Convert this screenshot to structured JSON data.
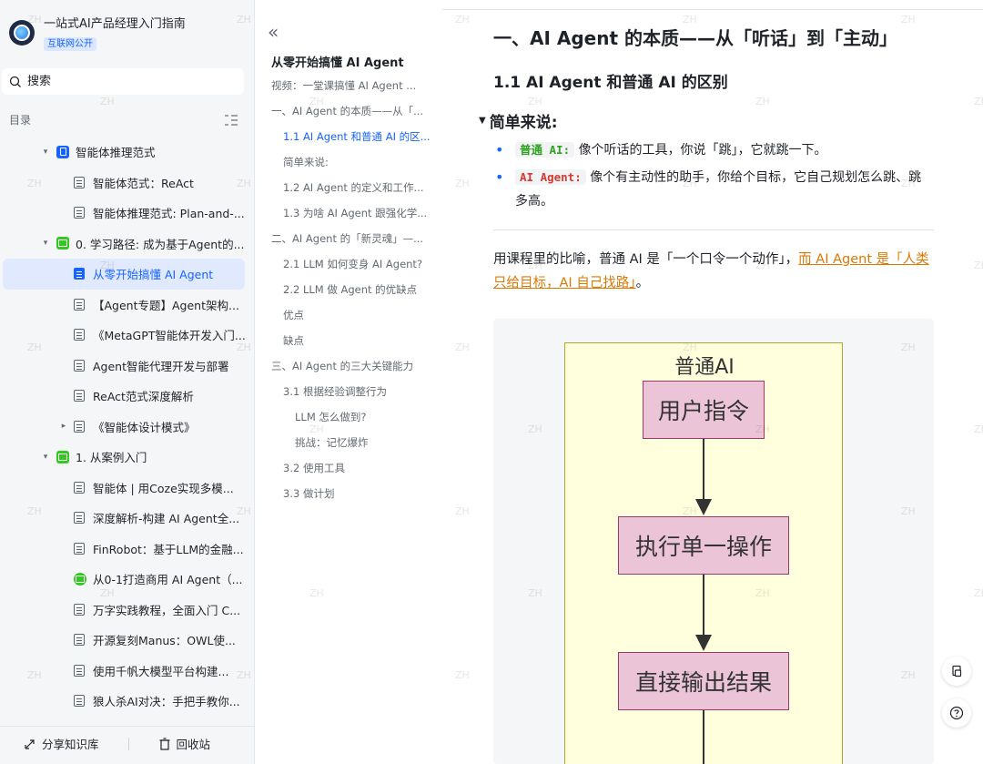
{
  "sidebar": {
    "kb_title": "一站式AI产品经理入门指南",
    "kb_badge": "互联网公开",
    "search_placeholder": "搜索",
    "toc_label": "目录",
    "items": [
      {
        "label": "智能体推理范式",
        "type": "folder-blue",
        "level": 1,
        "caret": "▾"
      },
      {
        "label": "智能体范式：ReAct",
        "type": "doc",
        "level": 2
      },
      {
        "label": "智能体推理范式: Plan-and-...",
        "type": "doc",
        "level": 2
      },
      {
        "label": "0. 学习路径: 成为基于Agent的...",
        "type": "folder-green",
        "level": 1,
        "caret": "▾"
      },
      {
        "label": "从零开始搞懂 AI Agent",
        "type": "doc",
        "level": 2,
        "active": true
      },
      {
        "label": "【Agent专题】Agent架构...",
        "type": "doc",
        "level": 2
      },
      {
        "label": "《MetaGPT智能体开发入门...",
        "type": "doc",
        "level": 2
      },
      {
        "label": "Agent智能代理开发与部署",
        "type": "doc",
        "level": 2
      },
      {
        "label": "ReAct范式深度解析",
        "type": "doc",
        "level": 2
      },
      {
        "label": "《智能体设计模式》",
        "type": "doc",
        "level": 2,
        "caret": "▸"
      },
      {
        "label": "1. 从案例入门",
        "type": "folder-green",
        "level": 1,
        "caret": "▾"
      },
      {
        "label": "智能体 | 用Coze实现多模...",
        "type": "doc",
        "level": 2
      },
      {
        "label": "深度解析-构建 AI Agent全...",
        "type": "doc",
        "level": 2
      },
      {
        "label": "FinRobot：基于LLM的金融...",
        "type": "doc",
        "level": 2
      },
      {
        "label": "从0-1打造商用 AI Agent（...",
        "type": "doc-green",
        "level": 2
      },
      {
        "label": "万字实践教程，全面入门 C...",
        "type": "doc",
        "level": 2
      },
      {
        "label": "开源复刻Manus：OWL使...",
        "type": "doc",
        "level": 2
      },
      {
        "label": "使用千帆大模型平台构建...",
        "type": "doc",
        "level": 2
      },
      {
        "label": "狼人杀AI对决：手把手教你...",
        "type": "doc",
        "level": 2
      }
    ],
    "footer": {
      "share": "分享知识库",
      "trash": "回收站"
    }
  },
  "outline": {
    "collapse": "«",
    "title": "从零开始搞懂 AI Agent",
    "items": [
      {
        "label": "视频：一堂课搞懂 AI Agent ...",
        "level": 0
      },
      {
        "label": "一、AI Agent 的本质——从「...",
        "level": 0
      },
      {
        "label": "1.1 AI Agent 和普通 AI 的区...",
        "level": 1,
        "active": true
      },
      {
        "label": "简单来说:",
        "level": 1
      },
      {
        "label": "1.2 AI Agent 的定义和工作...",
        "level": 1
      },
      {
        "label": "1.3 为啥 AI Agent 跟强化学...",
        "level": 1
      },
      {
        "label": "二、AI Agent 的「新灵魂」—...",
        "level": 0
      },
      {
        "label": "2.1 LLM 如何变身 AI Agent?",
        "level": 1
      },
      {
        "label": "2.2 LLM 做 Agent 的优缺点",
        "level": 1
      },
      {
        "label": "优点",
        "level": 1
      },
      {
        "label": "缺点",
        "level": 1
      },
      {
        "label": "三、AI Agent 的三大关键能力",
        "level": 0
      },
      {
        "label": "3.1 根据经验调整行为",
        "level": 1
      },
      {
        "label": "LLM 怎么做到?",
        "level": 2
      },
      {
        "label": "挑战：记忆爆炸",
        "level": 2
      },
      {
        "label": "3.2 使用工具",
        "level": 1
      },
      {
        "label": "3.3 做计划",
        "level": 1
      }
    ]
  },
  "content": {
    "h1": "一、AI Agent 的本质——从「听话」到「主动」",
    "h2": "1.1 AI Agent 和普通 AI 的区别",
    "h3": "简单来说:",
    "bullets": [
      {
        "code": "普通 AI:",
        "text": "像个听话的工具，你说「跳」，它就跳一下。"
      },
      {
        "code": "AI Agent:",
        "text": "像个有主动性的助手，你给个目标，它自己规划怎么跳、跳多高。"
      }
    ],
    "para_prefix": "用课程里的比喻，普通 AI 是「一个口令一个动作」，",
    "para_highlight": "而 AI Agent 是「人类只给目标，AI 自己找路」",
    "para_suffix": "。",
    "diagram": {
      "cluster": "普通AI",
      "nodes": [
        "用户指令",
        "执行单一操作",
        "直接输出结果"
      ]
    }
  },
  "watermark": "ZH",
  "colors": {
    "accent": "#1664ff",
    "highlight": "#de7802",
    "sidebar_bg": "#f5f6f7",
    "node_fill": "#ecc4d8",
    "cluster_fill": "#ffffde"
  }
}
